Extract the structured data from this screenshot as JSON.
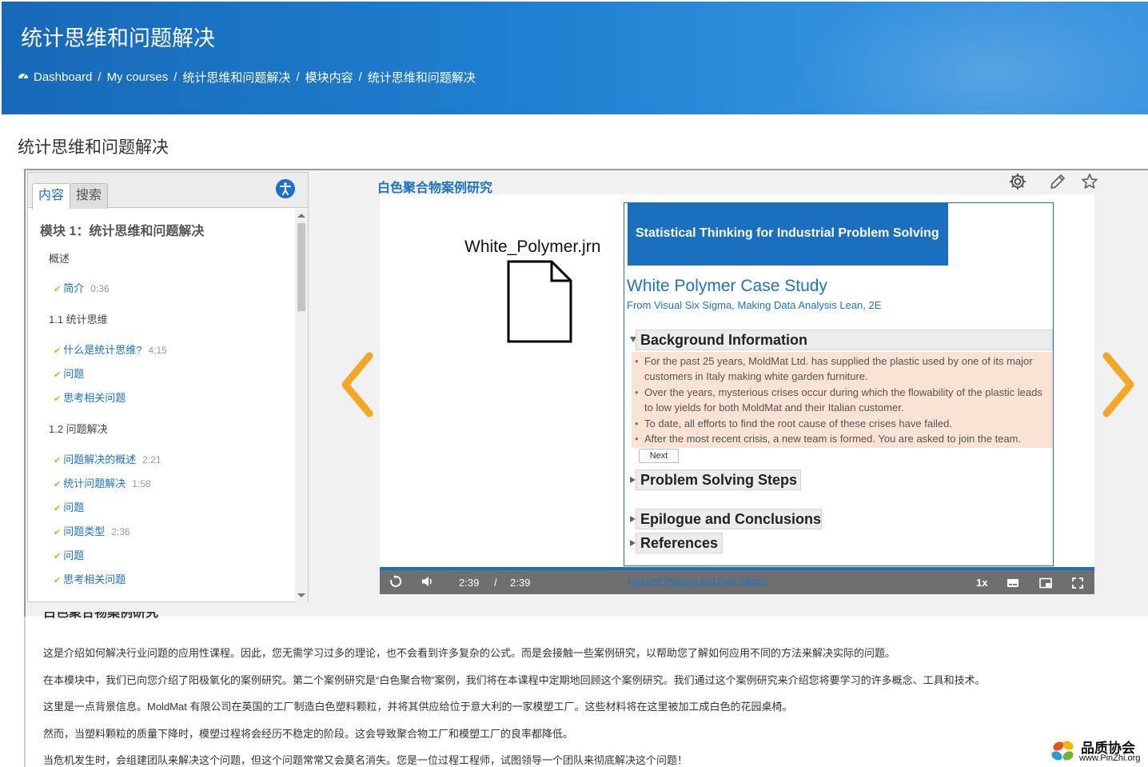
{
  "header": {
    "title": "统计思维和问题解决",
    "breadcrumb": [
      "Dashboard",
      "My courses",
      "统计思维和问题解决",
      "模块内容",
      "统计思维和问题解决"
    ]
  },
  "page_title": "统计思维和问题解决",
  "player": {
    "tabs": [
      "内容",
      "搜索"
    ],
    "slide_title": "白色聚合物案例研究",
    "toc": {
      "module": "模块 1：统计思维和问题解决",
      "items": [
        {
          "label": "概述",
          "type": "heading"
        },
        {
          "label": "简介",
          "duration": "0:36",
          "type": "link"
        },
        {
          "label": "1.1 统计思维",
          "type": "heading"
        },
        {
          "label": "什么是统计思维?",
          "duration": "4:15",
          "type": "link"
        },
        {
          "label": "问题",
          "duration": "",
          "type": "link"
        },
        {
          "label": "思考相关问题",
          "duration": "",
          "type": "link"
        },
        {
          "label": "1.2 问题解决",
          "type": "heading"
        },
        {
          "label": "问题解决的概述",
          "duration": "2:21",
          "type": "link"
        },
        {
          "label": "统计问题解决",
          "duration": "1:58",
          "type": "link"
        },
        {
          "label": "问题",
          "duration": "",
          "type": "link"
        },
        {
          "label": "问题类型",
          "duration": "2:36",
          "type": "link"
        },
        {
          "label": "问题",
          "duration": "",
          "type": "link"
        },
        {
          "label": "思考相关问题",
          "duration": "",
          "type": "link"
        }
      ]
    },
    "stage": {
      "file_name": "White_Polymer.jrn",
      "doc": {
        "banner": "Statistical Thinking for Industrial Problem Solving",
        "title": "White Polymer Case Study",
        "subtitle": "From Visual Six Sigma, Making Data Analysis Lean, 2E",
        "sections": {
          "background": "Background Information",
          "steps": "Problem Solving Steps",
          "epilogue": "Epilogue and Conclusions",
          "references": "References"
        },
        "bullets": [
          "For the past 25 years, MoldMat Ltd. has supplied the plastic used by one of its major customers in Italy making white garden furniture.",
          "Over the years, mysterious crises occur during which the flowability of the plastic leads to low yields for both MoldMat and their Italian customer.",
          "To date, all efforts to find the root cause of these crises have failed.",
          "After the most recent crisis, a new team is formed. You are asked to join the team."
        ],
        "next_label": "Next"
      }
    },
    "controls": {
      "current_time": "2:39",
      "separator": "/",
      "total_time": "2:39",
      "close_all": "Close All (Reports and Data Tables)",
      "speed": "1x"
    },
    "colors": {
      "accent": "#1a73c8",
      "arrow": "#f5a623",
      "highlight": "#fbe3d4"
    }
  },
  "description": {
    "heading": "白色聚合物案例研究",
    "paragraphs": [
      "这是介绍如何解决行业问题的应用性课程。因此，您无需学习过多的理论，也不会看到许多复杂的公式。而是会接触一些案例研究，以帮助您了解如何应用不同的方法来解决实际的问题。",
      "在本模块中，我们已向您介绍了阳极氧化的案例研究。第二个案例研究是“白色聚合物”案例，我们将在本课程中定期地回顾这个案例研究。我们通过这个案例研究来介绍您将要学习的许多概念、工具和技术。",
      "这里是一点背景信息。MoldMat 有限公司在英国的工厂制造白色塑料颗粒，并将其供应给位于意大利的一家模塑工厂。这些材料将在这里被加工成白色的花园桌椅。",
      "然而，当塑料颗粒的质量下降时，模塑过程将会经历不稳定的阶段。这会导致聚合物工厂和模塑工厂的良率都降低。",
      "当危机发生时，会组建团队来解决这个问题，但这个问题常常又会莫名消失。您是一位过程工程师，试图领导一个团队来彻底解决这个问题！"
    ]
  },
  "watermark": {
    "title": "品质协会",
    "url": "www.PinZhi.org"
  }
}
